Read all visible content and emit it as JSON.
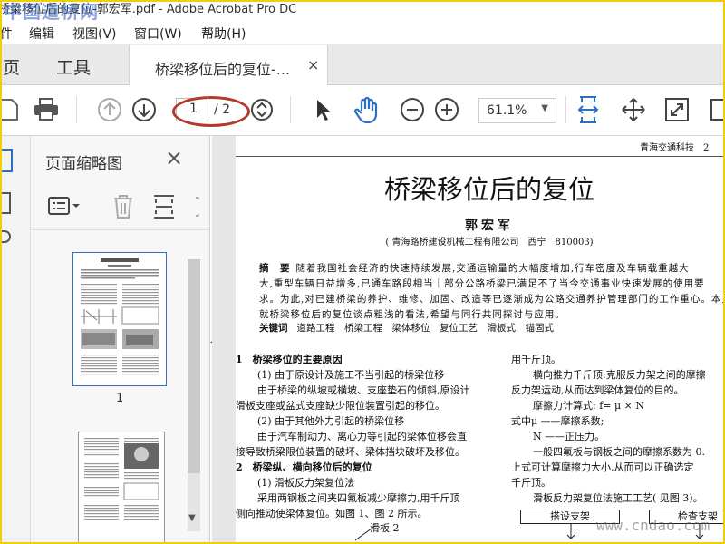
{
  "window": {
    "title": "桥梁移位后的复位-郭宏军.pdf - Adobe Acrobat Pro DC",
    "watermark_top": "中国道桥网",
    "watermark_bottom": "www.cndao.com"
  },
  "menu": [
    "件",
    "编辑",
    "视图(V)",
    "窗口(W)",
    "帮助(H)"
  ],
  "tabs": {
    "home": "主页",
    "tools": "工具",
    "doc": "桥梁移位后的复位-...",
    "close": "×"
  },
  "toolbar": {
    "page_current": "1",
    "page_total": "/ 2",
    "zoom": "61.1%"
  },
  "thumbnails": {
    "title": "页面缩略图",
    "close": "×",
    "page_label": "1"
  },
  "document": {
    "header": "青海交通科技　2",
    "title": "桥梁移位后的复位",
    "author": "郭宏军",
    "affiliation": "( 青海路桥建设机械工程有限公司　西宁　810003)",
    "abstract_label": "摘　要",
    "abstract_lines": [
      "随着我国社会经济的快速持续发展,交通运输量的大幅度增加,行车密度及车辆载重越大",
      "大,重型车辆日益增多,已通车路段相当｜部分公路桥梁已满足不了当今交通事业快速发展的使用要",
      "求。为此,对已建桥梁的养护、维修、加固、改造等已逐渐成为公路交通养护管理部门的工作重心。本文",
      "就桥梁移位后的复位谈点粗浅的看法,希望与同行共同探讨与应用。"
    ],
    "keywords_label": "关键词",
    "keywords": "道路工程　桥梁工程　梁体移位　复位工艺　滑板式　锚固式",
    "col1": [
      {
        "t": "1　桥梁移位的主要原因",
        "h": true,
        "i": false
      },
      {
        "t": "(1) 由于原设计及施工不当引起的桥梁位移",
        "h": false,
        "i": true
      },
      {
        "t": "由于桥梁的纵坡或横坡、支座垫石的倾斜,原设计",
        "h": false,
        "i": true
      },
      {
        "t": "滑板支座或盆式支座缺少限位装置引起的移位。",
        "h": false,
        "i": false
      },
      {
        "t": "(2) 由于其他外力引起的桥梁位移",
        "h": false,
        "i": true
      },
      {
        "t": "由于汽车制动力、离心力等引起的梁体位移会直",
        "h": false,
        "i": true
      },
      {
        "t": "接导致桥梁限位装置的破坏、梁体挡块破坏及移位。",
        "h": false,
        "i": false
      },
      {
        "t": "2　桥梁纵、横向移位后的复位",
        "h": true,
        "i": false
      },
      {
        "t": "(1) 滑板反力架复位法",
        "h": false,
        "i": true
      },
      {
        "t": "采用两钢板之间夹四氟板减少摩擦力,用千斤顶",
        "h": false,
        "i": true
      },
      {
        "t": "侧向推动使梁体复位。如图 1、图 2 所示。",
        "h": false,
        "i": false
      }
    ],
    "col2": [
      {
        "t": "用千斤顶。",
        "i": false
      },
      {
        "t": "横向推力千斤顶:克服反力架之间的摩擦",
        "i": true
      },
      {
        "t": "反力架运动,从而达到梁体复位的目的。",
        "i": false
      },
      {
        "t": "摩擦力计算式: f= μ × N",
        "i": true
      },
      {
        "t": "式中μ ——摩擦系数;",
        "i": false
      },
      {
        "t": "N ——正压力。",
        "i": true
      },
      {
        "t": "一般四氟板与钢板之间的摩擦系数为 0.",
        "i": true
      },
      {
        "t": "上式可计算摩擦力大小,从而可以正确选定",
        "i": false
      },
      {
        "t": "千斤顶。",
        "i": false
      },
      {
        "t": "滑板反力架复位法施工工艺( 见图 3)。",
        "i": true
      }
    ],
    "figure_label": "滑板 2",
    "flow_box1": "搭设支架",
    "flow_box2": "检查支架"
  },
  "colors": {
    "accent_blue": "#2f6fc0",
    "annotation_red": "#b03a2e",
    "frame_yellow": "#f0d000"
  }
}
